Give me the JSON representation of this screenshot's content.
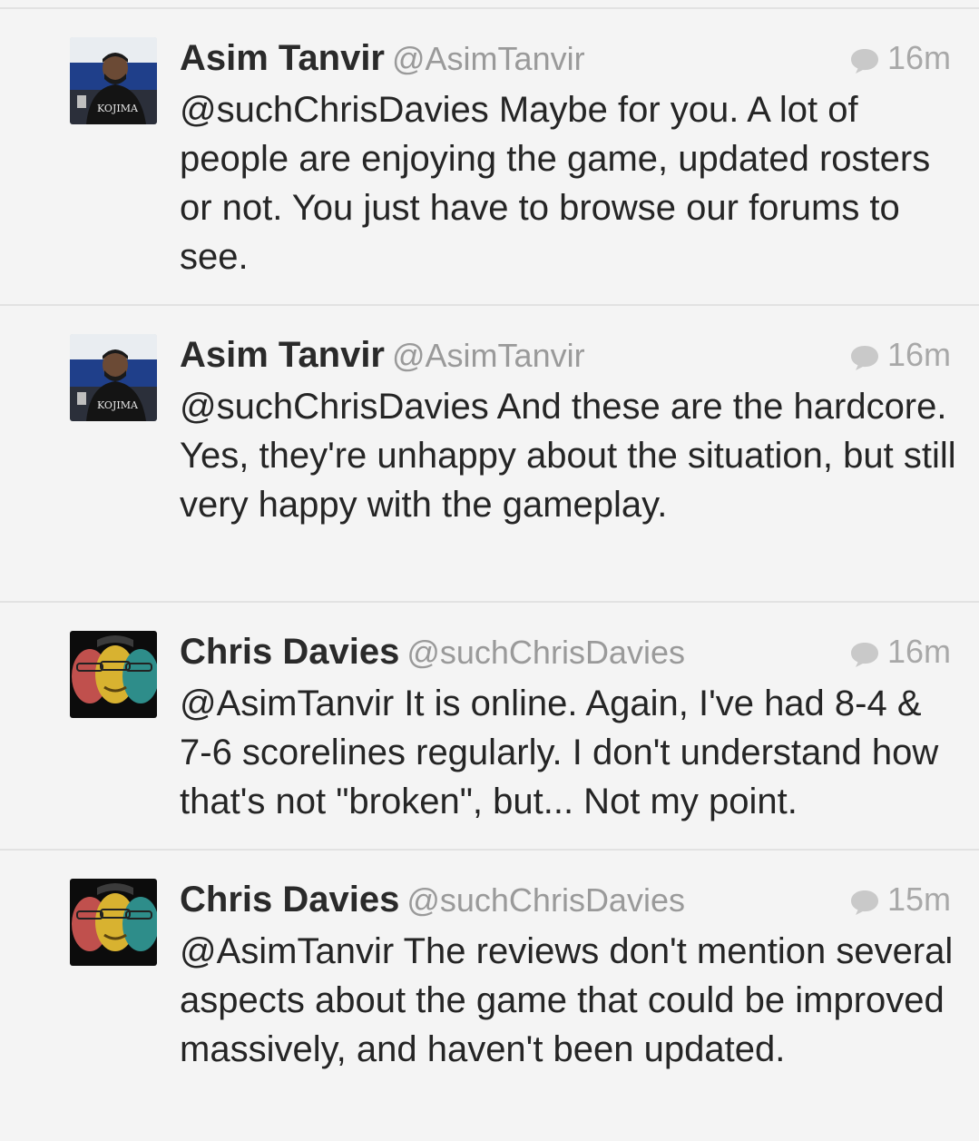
{
  "timeline": {
    "tweets": [
      {
        "name": "Asim Tanvir",
        "handle": "@AsimTanvir",
        "time": "16m",
        "avatar_icon": "asim-avatar",
        "text": "@suchChrisDavies Maybe for you. A lot of people are enjoying the game, updated rosters or not. You just have to browse our forums to see."
      },
      {
        "name": "Asim Tanvir",
        "handle": "@AsimTanvir",
        "time": "16m",
        "avatar_icon": "asim-avatar",
        "text": "@suchChrisDavies And these are the hardcore. Yes, they're unhappy about the situation, but still very happy with the gameplay."
      },
      {
        "name": "Chris Davies",
        "handle": "@suchChrisDavies",
        "time": "16m",
        "avatar_icon": "chris-avatar",
        "text": "@AsimTanvir It is online. Again, I've had 8-4 & 7-6 scorelines regularly. I don't understand how that's not \"broken\", but... Not my point."
      },
      {
        "name": "Chris Davies",
        "handle": "@suchChrisDavies",
        "time": "15m",
        "avatar_icon": "chris-avatar",
        "text": "@AsimTanvir The reviews don't mention several aspects about the game that could be improved massively, and haven't been updated."
      }
    ]
  },
  "colors": {
    "background": "#f4f4f4",
    "divider": "#e2e2e2",
    "name": "#2a2a2a",
    "handle": "#9a9a9a",
    "meta": "#a8a8a8"
  }
}
